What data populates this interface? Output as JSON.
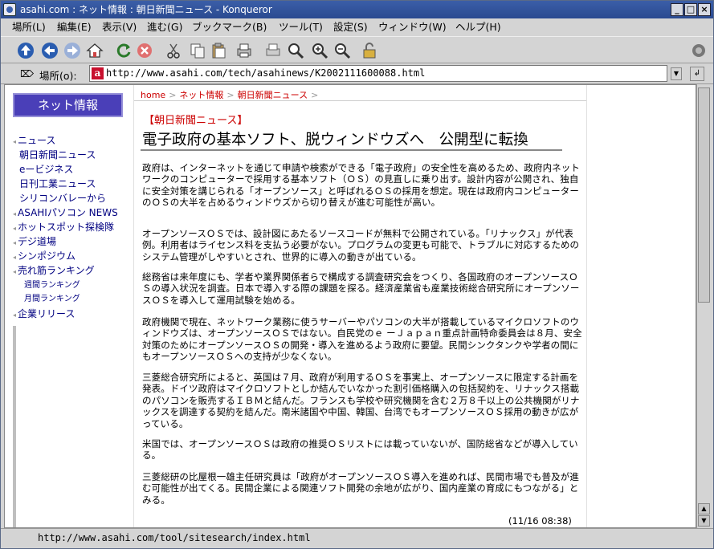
{
  "window": {
    "title": "asahi.com : ネット情報 : 朝日新聞ニュース - Konqueror"
  },
  "menu": [
    "場所(L)",
    "編集(E)",
    "表示(V)",
    "進む(G)",
    "ブックマーク(B)",
    "ツール(T)",
    "設定(S)",
    "ウィンドウ(W)",
    "ヘルプ(H)"
  ],
  "toolbar": {
    "icons": [
      "up-icon",
      "back-icon",
      "forward-icon",
      "home-icon",
      "reload-icon",
      "stop-icon",
      "cut-icon",
      "copy-icon",
      "paste-icon",
      "print-icon",
      "print-frame-icon",
      "zoom-fit-icon",
      "zoom-in-icon",
      "zoom-out-icon",
      "lock-icon"
    ]
  },
  "location": {
    "label": "場所(o):",
    "url": "http://www.asahi.com/tech/asahinews/K2002111600088.html"
  },
  "sidebar": {
    "heading": "ネット情報",
    "items": [
      {
        "label": "ニュース",
        "type": "section"
      },
      {
        "label": "朝日新聞ニュース",
        "type": "plain"
      },
      {
        "label": "eービジネス",
        "type": "plain"
      },
      {
        "label": "日刊工業ニュース",
        "type": "plain"
      },
      {
        "label": "シリコンバレーから",
        "type": "plain"
      },
      {
        "label": "ASAHIパソコン NEWS",
        "type": "section"
      },
      {
        "label": "ホットスポット探検隊",
        "type": "section"
      },
      {
        "label": "デジ道場",
        "type": "section"
      },
      {
        "label": "シンポジウム",
        "type": "section"
      },
      {
        "label": "売れ筋ランキング",
        "type": "section"
      },
      {
        "label": "週間ランキング",
        "type": "sub"
      },
      {
        "label": "月間ランキング",
        "type": "sub"
      },
      {
        "label": "企業リリース",
        "type": "section"
      }
    ]
  },
  "breadcrumb": {
    "home": "home",
    "level1": "ネット情報",
    "level2": "朝日新聞ニュース",
    "sep": ">"
  },
  "article": {
    "category": "【朝日新聞ニュース】",
    "headline": "電子政府の基本ソフト、脱ウィンドウズへ　公開型に転換",
    "paragraphs": [
      "政府は、インターネットを通じて申請や検索ができる「電子政府」の安全性を高めるため、政府内ネットワークのコンピューターで採用する基本ソフト（ＯＳ）の見直しに乗り出す。設計内容が公開され、独自に安全対策を講じられる「オープンソース」と呼ばれるＯＳの採用を想定。現在は政府内コンピューターのＯＳの大半を占めるウィンドウズから切り替えが進む可能性が高い。",
      "オープンソースＯＳでは、設計図にあたるソースコードが無料で公開されている。「リナックス」が代表例。利用者はライセンス料を支払う必要がない。プログラムの変更も可能で、トラブルに対応するためのシステム管理がしやすいとされ、世界的に導入の動きが出ている。",
      "総務省は来年度にも、学者や業界関係者らで構成する調査研究会をつくり、各国政府のオープンソースＯＳの導入状況を調査。日本で導入する際の課題を探る。経済産業省も産業技術総合研究所にオープンソースＯＳを導入して運用試験を始める。",
      "政府機関で現在、ネットワーク業務に使うサーバーやパソコンの大半が搭載しているマイクロソフトのウィンドウズは、オープンソースＯＳではない。自民党のｅ ーＪａｐａｎ重点計画特命委員会は８月、安全対策のためにオープンソースＯＳの開発・導入を進めるよう政府に要望。民間シンクタンクや学者の間にもオープンソースＯＳへの支持が少なくない。",
      "三菱総合研究所によると、英国は７月、政府が利用するＯＳを事実上、オープンソースに限定する計画を発表。ドイツ政府はマイクロソフトとしか結んでいなかった割引価格購入の包括契約を、リナックス搭載のパソコンを販売するＩＢＭと結んだ。フランスも学校や研究機関を含む２万８千以上の公共機関がリナックスを調達する契約を結んだ。南米諸国や中国、韓国、台湾でもオープンソースＯＳ採用の動きが広がっている。",
      "米国では、オープンソースＯＳは政府の推奨ＯＳリストには載っていないが、国防総省などが導入している。",
      "三菱総研の比屋根一雄主任研究員は「政府がオープンソースＯＳ導入を進めれば、民間市場でも普及が進む可能性が出てくる。民間企業による関連ソフト開発の余地が広がり、国内産業の育成にもつながる」とみる。"
    ],
    "timestamp": "(11/16 08:38)"
  },
  "status": {
    "text": "http://www.asahi.com/tool/sitesearch/index.html"
  }
}
